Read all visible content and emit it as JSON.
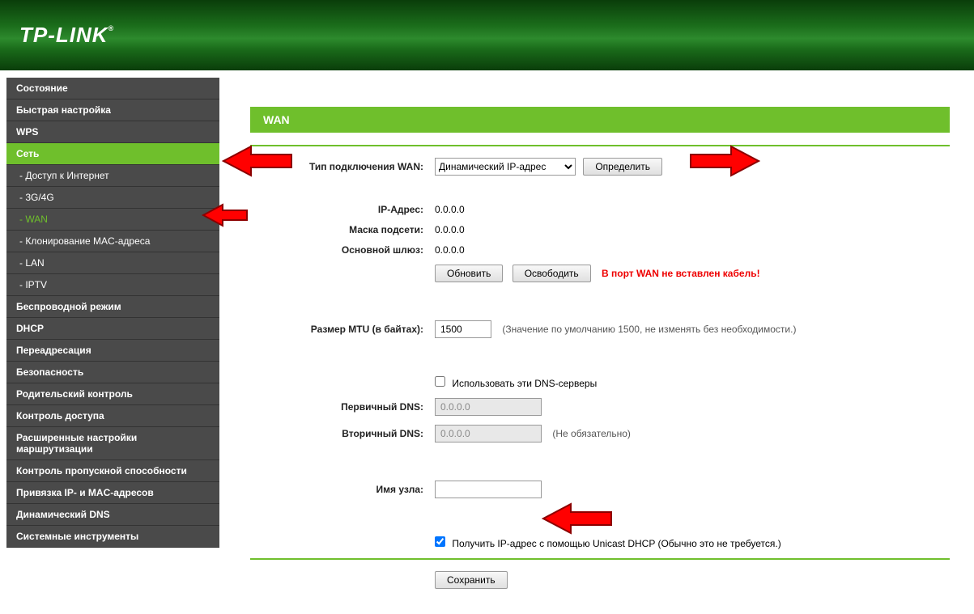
{
  "logo": "TP-LINK",
  "sidebar": {
    "items": [
      {
        "label": "Состояние",
        "sub": false
      },
      {
        "label": "Быстрая настройка",
        "sub": false
      },
      {
        "label": "WPS",
        "sub": false
      },
      {
        "label": "Сеть",
        "sub": false,
        "active": true
      },
      {
        "label": "- Доступ к Интернет",
        "sub": true
      },
      {
        "label": "- 3G/4G",
        "sub": true
      },
      {
        "label": "- WAN",
        "sub": true,
        "subActive": true
      },
      {
        "label": "- Клонирование MAC-адреса",
        "sub": true
      },
      {
        "label": "- LAN",
        "sub": true
      },
      {
        "label": "- IPTV",
        "sub": true
      },
      {
        "label": "Беспроводной режим",
        "sub": false
      },
      {
        "label": "DHCP",
        "sub": false
      },
      {
        "label": "Переадресация",
        "sub": false
      },
      {
        "label": "Безопасность",
        "sub": false
      },
      {
        "label": "Родительский контроль",
        "sub": false
      },
      {
        "label": "Контроль доступа",
        "sub": false
      },
      {
        "label": "Расширенные настройки маршрутизации",
        "sub": false
      },
      {
        "label": "Контроль пропускной способности",
        "sub": false
      },
      {
        "label": "Привязка IP- и MAC-адресов",
        "sub": false
      },
      {
        "label": "Динамический DNS",
        "sub": false
      },
      {
        "label": "Системные инструменты",
        "sub": false
      }
    ]
  },
  "page": {
    "title": "WAN"
  },
  "form": {
    "wan_type_label": "Тип подключения WAN:",
    "wan_type_value": "Динамический IP-адрес",
    "detect_btn": "Определить",
    "ip_label": "IP-Адрес:",
    "ip_value": "0.0.0.0",
    "mask_label": "Маска подсети:",
    "mask_value": "0.0.0.0",
    "gw_label": "Основной шлюз:",
    "gw_value": "0.0.0.0",
    "refresh_btn": "Обновить",
    "release_btn": "Освободить",
    "wan_warn": "В порт WAN не вставлен кабель!",
    "mtu_label": "Размер MTU (в байтах):",
    "mtu_value": "1500",
    "mtu_hint": "(Значение по умолчанию 1500, не изменять без необходимости.)",
    "use_dns_label": "Использовать эти DNS-серверы",
    "dns1_label": "Первичный DNS:",
    "dns1_value": "0.0.0.0",
    "dns2_label": "Вторичный DNS:",
    "dns2_value": "0.0.0.0",
    "dns2_hint": "(Не обязательно)",
    "host_label": "Имя узла:",
    "host_value": "",
    "unicast_label": "Получить IP-адрес с помощью Unicast DHCP (Обычно это не требуется.)",
    "save_btn": "Сохранить"
  }
}
